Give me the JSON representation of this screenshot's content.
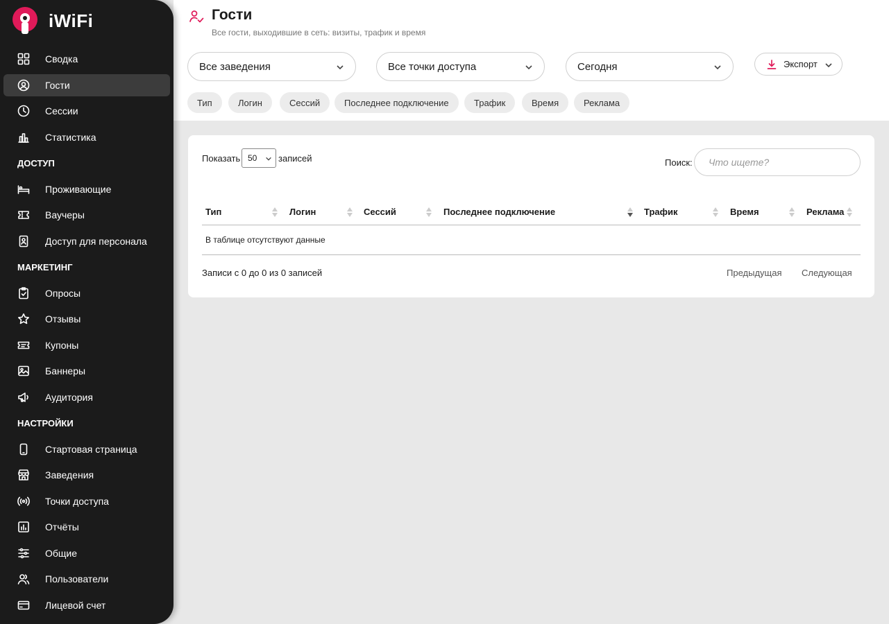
{
  "brand": {
    "name": "iWiFi",
    "accent": "#e01a59",
    "sidebar_bg": "#1b1b1b"
  },
  "sidebar": {
    "items_top": [
      {
        "label": "Сводка",
        "icon": "dashboard-icon",
        "active": false
      },
      {
        "label": "Гости",
        "icon": "user-circle-icon",
        "active": true
      },
      {
        "label": "Сессии",
        "icon": "clock-icon",
        "active": false
      },
      {
        "label": "Статистика",
        "icon": "bar-chart-icon",
        "active": false
      }
    ],
    "section_access": "ДОСТУП",
    "items_access": [
      {
        "label": "Проживающие",
        "icon": "bed-icon"
      },
      {
        "label": "Ваучеры",
        "icon": "ticket-icon"
      },
      {
        "label": "Доступ для персонала",
        "icon": "badge-icon"
      }
    ],
    "section_marketing": "МАРКЕТИНГ",
    "items_marketing": [
      {
        "label": "Опросы",
        "icon": "clipboard-check-icon"
      },
      {
        "label": "Отзывы",
        "icon": "star-icon"
      },
      {
        "label": "Купоны",
        "icon": "coupon-icon"
      },
      {
        "label": "Баннеры",
        "icon": "image-icon"
      },
      {
        "label": "Аудитория",
        "icon": "megaphone-icon"
      }
    ],
    "section_settings": "НАСТРОЙКИ",
    "items_settings": [
      {
        "label": "Стартовая страница",
        "icon": "phone-icon"
      },
      {
        "label": "Заведения",
        "icon": "store-icon"
      },
      {
        "label": "Точки доступа",
        "icon": "broadcast-icon"
      },
      {
        "label": "Отчёты",
        "icon": "report-icon"
      },
      {
        "label": "Общие",
        "icon": "sliders-icon"
      },
      {
        "label": "Пользователи",
        "icon": "users-icon"
      },
      {
        "label": "Лицевой счет",
        "icon": "wallet-icon"
      }
    ]
  },
  "header": {
    "title": "Гости",
    "subtitle": "Все гости, выходившие в сеть: визиты, трафик и время",
    "filters": {
      "venue": "Все заведения",
      "access_points": "Все точки доступа",
      "period": "Сегодня"
    },
    "export_label": "Экспорт",
    "column_chips": [
      "Тип",
      "Логин",
      "Сессий",
      "Последнее подключение",
      "Трафик",
      "Время",
      "Реклама"
    ]
  },
  "table": {
    "show_label": "Показать",
    "page_size": "50",
    "records_label": "записей",
    "search_label": "Поиск:",
    "search_placeholder": "Что ищете?",
    "columns": [
      "Тип",
      "Логин",
      "Сессий",
      "Последнее подключение",
      "Трафик",
      "Время",
      "Реклама"
    ],
    "sorted_column": "Последнее подключение",
    "empty_text": "В таблице отсутствуют данные",
    "info": "Записи с 0 до 0 из 0 записей",
    "prev_label": "Предыдущая",
    "next_label": "Следующая"
  }
}
